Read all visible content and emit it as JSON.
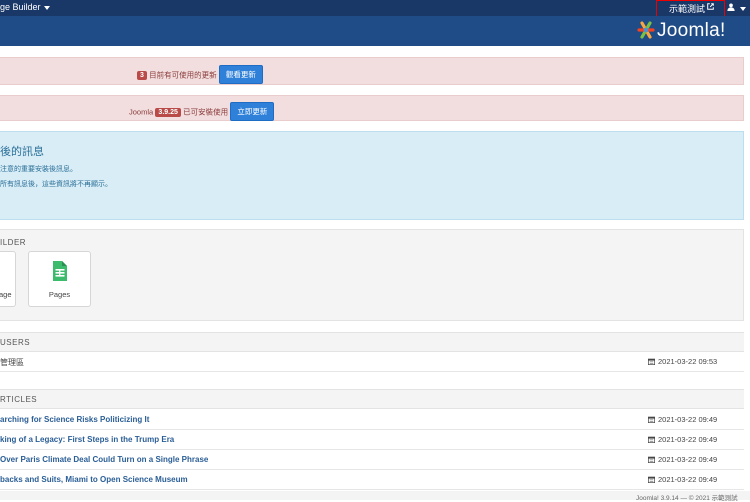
{
  "topbar": {
    "menu_label": "ge Builder",
    "site_link": "示範測試"
  },
  "header": {
    "logo_text": "Joomla!"
  },
  "alerts": {
    "extensions": {
      "badge": "3",
      "text": "目前有可使用的更新",
      "button": "觀看更新"
    },
    "core": {
      "prefix": "Joomla",
      "version": "3.9.25",
      "text": "已可安裝使用",
      "button": "立即更新"
    }
  },
  "messages": {
    "title": "後的訊息",
    "line1": "注意的重要安裝後訊息。",
    "line2": "所有訊息後，這些資訊將不再顯示。"
  },
  "builder": {
    "title": "ILDER",
    "tiles": [
      {
        "label": "age"
      },
      {
        "label": "Pages"
      }
    ]
  },
  "users": {
    "title": "USERS",
    "rows": [
      {
        "name": "管理區",
        "date": "2021-03-22 09:53"
      }
    ]
  },
  "articles": {
    "title": "RTICLES",
    "rows": [
      {
        "title": "arching for Science Risks Politicizing It",
        "date": "2021-03-22 09:49"
      },
      {
        "title": "king of a Legacy: First Steps in the Trump Era",
        "date": "2021-03-22 09:49"
      },
      {
        "title": "Over Paris Climate Deal Could Turn on a Single Phrase",
        "date": "2021-03-22 09:49"
      },
      {
        "title": "backs and Suits, Miami to Open Science Museum",
        "date": "2021-03-22 09:49"
      }
    ]
  },
  "footer": {
    "text": "Joomla! 3.9.14 — © 2021 示範測試"
  },
  "colors": {
    "topbar": "#1a3867",
    "header": "#1f4b86",
    "button": "#2f80d8",
    "badge": "#b94a48"
  }
}
